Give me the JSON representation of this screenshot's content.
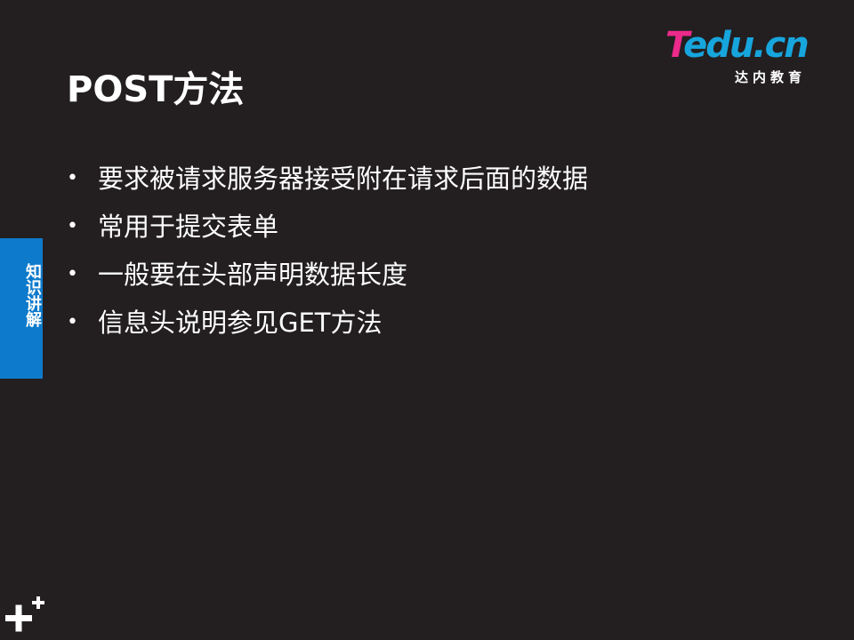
{
  "slide": {
    "title": "POST方法",
    "logo": {
      "word_t": "T",
      "word_rest": "edu.cn",
      "subtitle": "达内教育",
      "colors": {
        "t": "#ec2a8a",
        "rest": "#17a5dd"
      }
    },
    "bullets": [
      {
        "marker": "•",
        "text": "要求被请求服务器接受附在请求后面的数据"
      },
      {
        "marker": "•",
        "text": "常用于提交表单"
      },
      {
        "marker": "•",
        "text": "一般要在头部声明数据长度"
      },
      {
        "marker": "•",
        "text": "信息头说明参见GET方法"
      }
    ],
    "side_tab": {
      "label": "知识讲解",
      "color": "#0d7acb"
    },
    "background_color": "#231f20",
    "corner_icon": "plus-plus-icon"
  }
}
